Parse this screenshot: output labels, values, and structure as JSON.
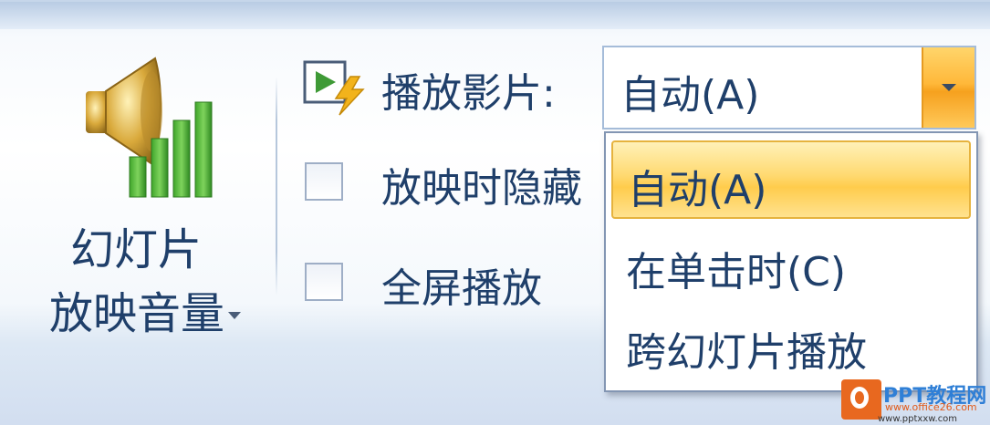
{
  "ribbon": {
    "volume_button": {
      "icon": "speaker-volume-icon",
      "label_line1": "幻灯片",
      "label_line2": "放映音量"
    },
    "play_movie": {
      "icon": "movie-play-icon",
      "label": "播放影片:",
      "selected_value": "自动(A)"
    },
    "checkboxes": [
      {
        "label": "放映时隐藏",
        "checked": false
      },
      {
        "label": "全屏播放",
        "checked": false
      }
    ],
    "dropdown": {
      "options": [
        "自动(A)",
        "在单击时(C)",
        "跨幻灯片播放"
      ],
      "highlighted_index": 0
    }
  },
  "watermark": {
    "title": "PPT教程网",
    "line2": "www.office26.com",
    "line3": "www.pptxxw.com"
  },
  "colors": {
    "text": "#1f3f6a",
    "highlight": "#ffd96f",
    "combo_button": "#ffb83a",
    "watermark_orange": "#e8681f"
  }
}
